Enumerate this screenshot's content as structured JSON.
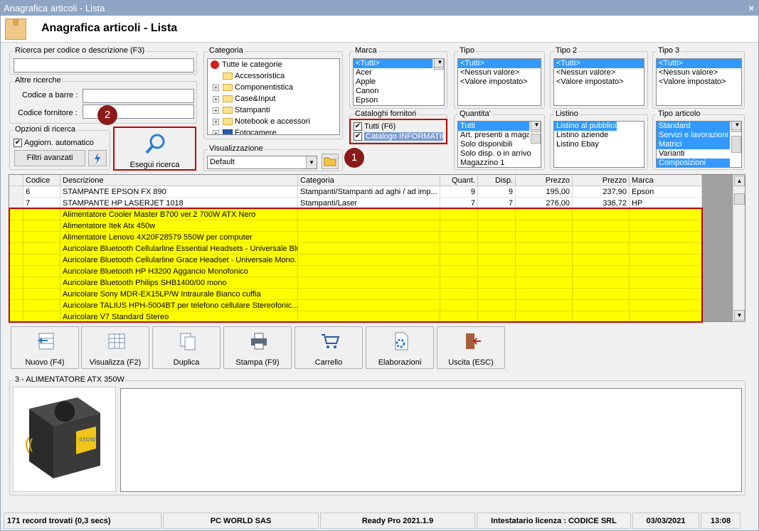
{
  "window": {
    "title": "Anagrafica articoli  - Lista",
    "close": "×"
  },
  "header": {
    "title": "Anagrafica articoli  - Lista"
  },
  "search": {
    "label": "Ricerca per codice o descrizione (F3)",
    "value": ""
  },
  "other": {
    "legend": "Altre ricerche",
    "barcode_label": "Codice a barre :",
    "supplier_label": "Codice fornitore :",
    "barcode_value": "",
    "supplier_value": ""
  },
  "options": {
    "legend": "Opzioni di ricerca",
    "auto_update": "Aggiorn. automatico",
    "auto_checked": "✔",
    "advanced": "Filtri avanzati"
  },
  "search_button": {
    "label": "Esegui ricerca"
  },
  "category": {
    "legend": "Categoria",
    "root": "Tutte le categorie",
    "items": [
      "Accessoristica",
      "Componentistica",
      "Case&Input",
      "Stampanti",
      "Notebook e accessori",
      "Fotocamere"
    ]
  },
  "view": {
    "legend": "Visualizzazione",
    "value": "Default"
  },
  "brand": {
    "legend": "Marca",
    "items": [
      "<Tutti>",
      "Acer",
      "Apple",
      "Canon",
      "Epson"
    ]
  },
  "catalogs": {
    "legend": "Cataloghi fornitori",
    "items": [
      "Tutti (F6)",
      "Catalogo INFORMATICA"
    ],
    "check": "✔"
  },
  "tipo": {
    "legend": "Tipo",
    "items": [
      "<Tutti>",
      "<Nessun valore>",
      "<Valore impostato>"
    ]
  },
  "tipo2": {
    "legend": "Tipo 2",
    "items": [
      "<Tutti>",
      "<Nessun valore>",
      "<Valore impostato>"
    ]
  },
  "tipo3": {
    "legend": "Tipo 3",
    "items": [
      "<Tutti>",
      "<Nessun valore>",
      "<Valore impostato>"
    ]
  },
  "quantity": {
    "legend": "Quantita'",
    "items": [
      "Tutti",
      "Art. presenti a magazzino",
      "Solo disponibili",
      "Solo disp. o in arrivo",
      "Magazzino 1"
    ]
  },
  "pricelist": {
    "legend": "Listino",
    "items": [
      "Listino al pubblico",
      "Listino aziende",
      "Listino Ebay"
    ]
  },
  "article_type": {
    "legend": "Tipo articolo",
    "items": [
      "Standard",
      "Servizi e lavorazioni",
      "Matrici",
      "Varianti",
      "Composizioni"
    ]
  },
  "badges": {
    "one": "1",
    "two": "2"
  },
  "table": {
    "headers": [
      "Codice",
      "Descrizione",
      "Categoria",
      "Quant.",
      "Disp.",
      "Prezzo",
      "Prezzo",
      "Marca"
    ],
    "rows": [
      [
        "6",
        "STAMPANTE EPSON FX 890",
        "Stampanti/Stampanti ad aghi / ad imp...",
        "9",
        "9",
        "195,00",
        "237,90",
        "Epson"
      ],
      [
        "7",
        "STAMPANTE HP LASERJET 1018",
        "Stampanti/Laser",
        "7",
        "7",
        "276,00",
        "336,72",
        "HP"
      ]
    ],
    "catalog_rows": [
      "Alimentatore Cooler Master B700 ver.2 700W ATX Nero",
      "Alimentatore Itek Atx 450w",
      "Alimentatore Lenovo 4X20F28579 550W per computer",
      "Auricolare Bluetooth Cellularline Essential Headsets - Universale Blu",
      "Auricolare Bluetooth Cellularline Grace Headset - Universale Mono...",
      "Auricolare Bluetooth HP H3200 Aggancio Monofonico",
      "Auricolare Bluetooth Philips SHB1400/00 mono",
      "Auricolare Sony MDR-EX15LP/W Intraurale Bianco cuffia",
      "Auricolare TALIUS HPH-5004BT per telefono cellulare Stereofonic...",
      "Auricolare V7 Standard Stereo"
    ]
  },
  "toolbar": {
    "new": "Nuovo (F4)",
    "view": "Visualizza (F2)",
    "duplicate": "Duplica",
    "print": "Stampa (F9)",
    "cart": "Carrello",
    "process": "Elaborazioni",
    "exit": "Uscita (ESC)"
  },
  "detail": {
    "legend": "3 - ALIMENTATORE ATX 350W",
    "psu_label": "450W",
    "notes": ""
  },
  "status": {
    "records": "171 record trovati (0,3 secs)",
    "company": "PC WORLD SAS",
    "version": "Ready Pro 2021.1.9",
    "license": "Intestatario licenza : CODICE SRL",
    "date": "03/03/2021",
    "time": "13:08"
  }
}
